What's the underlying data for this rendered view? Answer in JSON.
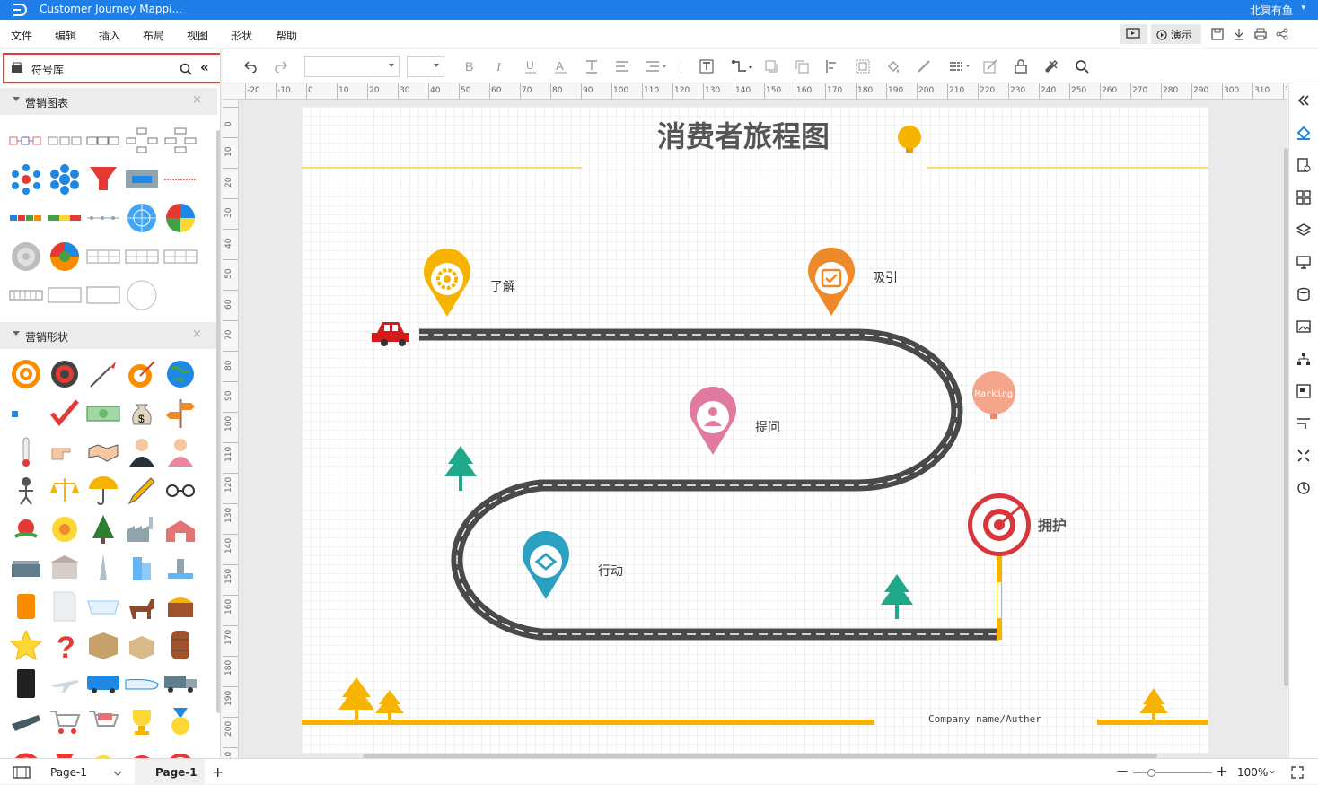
{
  "window": {
    "title": "Customer Journey Mappi...",
    "user": "北冥有鱼",
    "user_caret": "▾"
  },
  "menu": [
    "文件",
    "编辑",
    "插入",
    "布局",
    "视图",
    "形状",
    "帮助"
  ],
  "menu_right": {
    "present_label": "演示"
  },
  "library": {
    "label": "符号库",
    "collapse": "«",
    "sections": [
      {
        "name": "营销图表",
        "close": "×"
      },
      {
        "name": "营销形状",
        "close": "×"
      }
    ]
  },
  "toolbar": {
    "font_family": "",
    "font_size": ""
  },
  "ruler": {
    "h": [
      "-20",
      "-10",
      "0",
      "10",
      "20",
      "30",
      "40",
      "50",
      "60",
      "70",
      "80",
      "90",
      "100",
      "110",
      "120",
      "130",
      "140",
      "150",
      "160",
      "170",
      "180",
      "190",
      "200",
      "210",
      "220",
      "230",
      "240",
      "250",
      "260",
      "270",
      "280",
      "290",
      "300",
      "310",
      "32"
    ],
    "v": [
      "0",
      "10",
      "20",
      "30",
      "40",
      "50",
      "60",
      "70",
      "80",
      "90",
      "100",
      "110",
      "120",
      "130",
      "140",
      "150",
      "160",
      "170",
      "180",
      "190",
      "200",
      "210"
    ]
  },
  "diagram": {
    "title": "消费者旅程图",
    "stages": [
      {
        "label": "了解",
        "color": "#f6b400"
      },
      {
        "label": "吸引",
        "color": "#ef8a2a"
      },
      {
        "label": "提问",
        "color": "#e07aa0"
      },
      {
        "label": "行动",
        "color": "#2aa1c0"
      },
      {
        "label": "拥护",
        "color": "#d6363c"
      }
    ],
    "balloon_text": "Marking",
    "footer": "Company name/Auther",
    "accent": "#f6b400",
    "road": "#4a4a4a"
  },
  "status": {
    "page_dropdown": "Page-1",
    "page_tab": "Page-1",
    "add": "+",
    "zoom_minus": "—",
    "zoom_plus": "+",
    "zoom": "100%",
    "zoom_caret": "⌄"
  }
}
